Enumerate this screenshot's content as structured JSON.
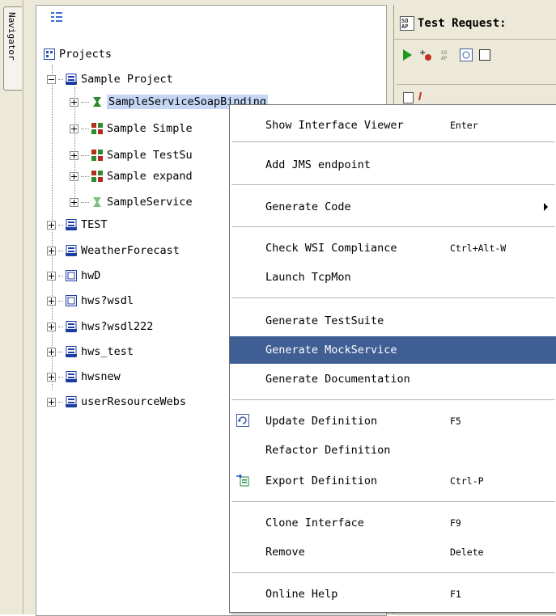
{
  "navigator_tab_label": "Navigator",
  "tree": {
    "root_label": "Projects",
    "items": [
      {
        "label": "Sample Project",
        "level": 1,
        "expanded": true,
        "icon": "project-icon"
      },
      {
        "label": "SampleServiceSoapBinding",
        "level": 2,
        "expanded": false,
        "icon": "interface-icon",
        "selected": true
      },
      {
        "label": "Sample Simple",
        "level": 2,
        "expanded": false,
        "icon": "testsuite-icon"
      },
      {
        "label": "Sample TestSu",
        "level": 2,
        "expanded": false,
        "icon": "testsuite-icon"
      },
      {
        "label": "Sample expand",
        "level": 2,
        "expanded": false,
        "icon": "testsuite-icon"
      },
      {
        "label": "SampleService",
        "level": 2,
        "expanded": false,
        "icon": "interface-icon"
      },
      {
        "label": "TEST",
        "level": 0,
        "expanded": false,
        "icon": "project-icon"
      },
      {
        "label": "WeatherForecast",
        "level": 0,
        "expanded": false,
        "icon": "project-icon"
      },
      {
        "label": "hwD",
        "level": 0,
        "expanded": false,
        "icon": "project-icon"
      },
      {
        "label": "hws?wsdl",
        "level": 0,
        "expanded": false,
        "icon": "project-icon"
      },
      {
        "label": "hws?wsdl222",
        "level": 0,
        "expanded": false,
        "icon": "project-icon"
      },
      {
        "label": "hws_test",
        "level": 0,
        "expanded": false,
        "icon": "project-icon"
      },
      {
        "label": "hwsnew",
        "level": 0,
        "expanded": false,
        "icon": "project-icon"
      },
      {
        "label": "userResourceWebs",
        "level": 0,
        "expanded": false,
        "icon": "project-icon"
      }
    ]
  },
  "right_panel": {
    "title": "Test Request:",
    "title_icon": "soap-icon",
    "toolbar_icons": [
      "run-icon",
      "add-assertion-icon",
      "soap-icon",
      "refresh-icon",
      "checkbox-icon"
    ]
  },
  "context_menu": {
    "items": [
      {
        "label": "Show Interface Viewer",
        "accel": "Enter"
      },
      {
        "label": "Add JMS endpoint",
        "accel": ""
      },
      {
        "label": "Generate Code",
        "accel": "",
        "submenu": true
      },
      {
        "label": "Check WSI Compliance",
        "accel": "Ctrl+Alt-W"
      },
      {
        "label": "Launch TcpMon",
        "accel": ""
      },
      {
        "label": "Generate TestSuite",
        "accel": ""
      },
      {
        "label": "Generate MockService",
        "accel": "",
        "highlighted": true
      },
      {
        "label": "Generate Documentation",
        "accel": ""
      },
      {
        "label": "Update Definition",
        "accel": "F5",
        "icon": "update-icon"
      },
      {
        "label": "Refactor Definition",
        "accel": ""
      },
      {
        "label": "Export Definition",
        "accel": "Ctrl-P",
        "icon": "export-icon"
      },
      {
        "label": "Clone Interface",
        "accel": "F9"
      },
      {
        "label": "Remove",
        "accel": "Delete"
      },
      {
        "label": "Online Help",
        "accel": "F1"
      }
    ]
  },
  "colors": {
    "menu_highlight": "#3f5e94",
    "tree_selection": "#c5d7f5",
    "chrome": "#ece9d8"
  }
}
